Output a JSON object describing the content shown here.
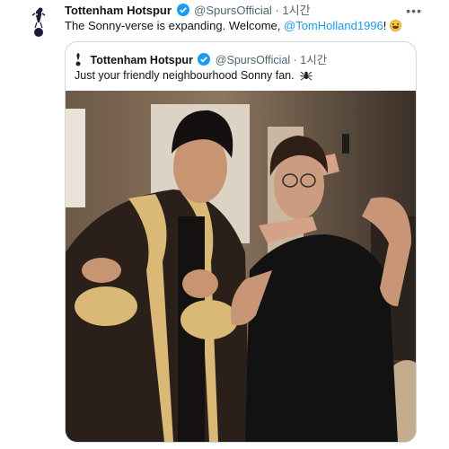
{
  "tweet": {
    "author_name": "Tottenham Hotspur",
    "handle": "@SpursOfficial",
    "separator": "·",
    "time": "1시간",
    "text_before": "The Sonny-verse is expanding. Welcome, ",
    "mention": "@TomHolland1996",
    "text_after": "!",
    "emoji_icon": "grinning-face-emoji",
    "more_icon": "more-dots-icon"
  },
  "quoted": {
    "author_name": "Tottenham Hotspur",
    "handle": "@SpursOfficial",
    "separator": "·",
    "time": "1시간",
    "text": "Just your friendly neighbourhood Sonny fan.",
    "emoji_icon": "spider-emoji"
  },
  "colors": {
    "link": "#1d9bf0",
    "verified": "#1d9bf0",
    "secondary_text": "#536471",
    "border": "#cfd9de"
  }
}
